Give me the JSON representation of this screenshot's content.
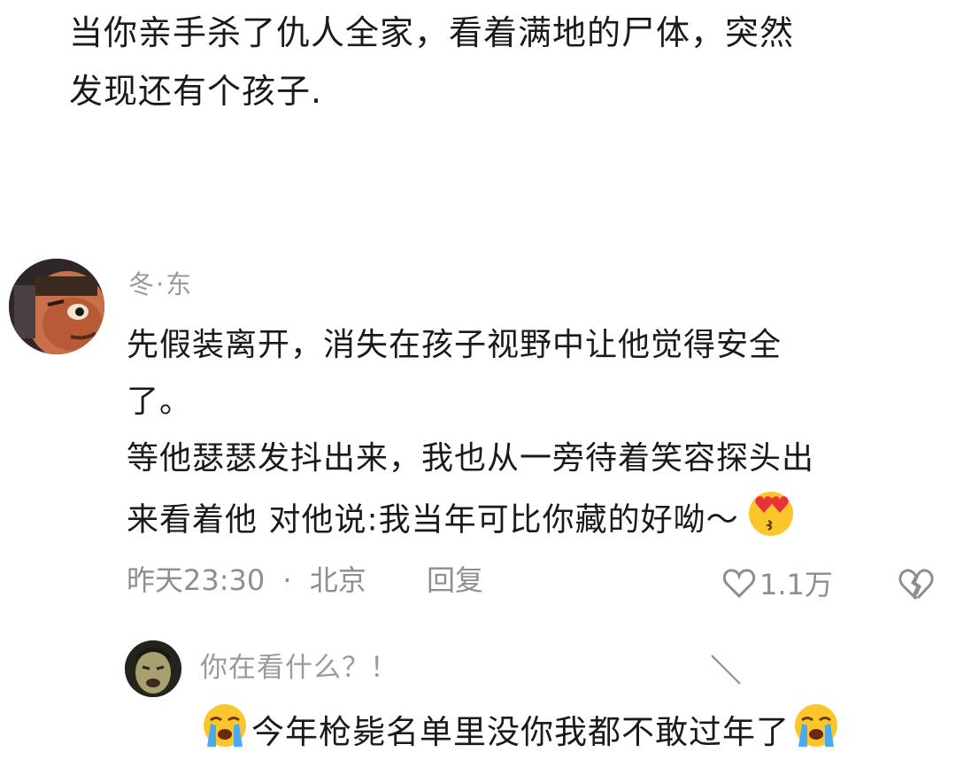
{
  "post": {
    "line1": "当你亲手杀了仇人全家，看着满地的尸体，突然",
    "line2": "发现还有个孩子."
  },
  "comment": {
    "avatar_icon": "cartoon-face-avatar",
    "username": "冬·东",
    "body_lines": [
      "先假装离开，消失在孩子视野中让他觉得安全",
      "了。",
      "等他瑟瑟发抖出来，我也从一旁待着笑容探头出",
      "来看着他 对他说:我当年可比你藏的好呦～"
    ],
    "trailing_emoji": "heart-eyes-kiss-emoji",
    "time": "昨天23:30",
    "separator": "·",
    "location": "北京",
    "reply_label": "回复",
    "like_icon": "heart-outline-icon",
    "like_count": "1.1万",
    "dislike_icon": "broken-heart-icon"
  },
  "reply": {
    "avatar_icon": "crying-man-avatar",
    "username": "你在看什么？！",
    "leading_emoji": "loudly-crying-emoji",
    "text": "今年枪毙名单里没你我都不敢过年了",
    "trailing_emoji": "loudly-crying-emoji"
  },
  "colors": {
    "text_primary": "#1a1a1a",
    "text_secondary": "#8e8e8e",
    "background": "#ffffff"
  }
}
